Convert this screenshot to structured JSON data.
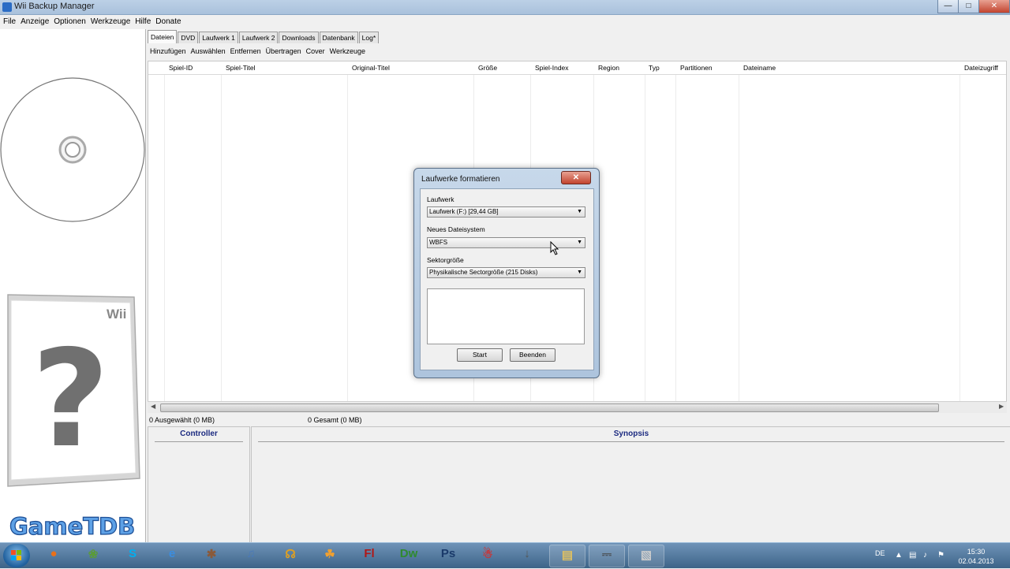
{
  "window": {
    "title": "Wii Backup Manager",
    "controls": {
      "minimize": "—",
      "maximize": "□",
      "close": "✕"
    }
  },
  "menu": [
    "File",
    "Anzeige",
    "Optionen",
    "Werkzeuge",
    "Hilfe",
    "Donate"
  ],
  "tabs": [
    "Dateien",
    "DVD",
    "Laufwerk 1",
    "Laufwerk 2",
    "Downloads",
    "Datenbank",
    "Log*"
  ],
  "active_tab": "Dateien",
  "toolbar": [
    "Hinzufügen",
    "Auswählen",
    "Entfernen",
    "Übertragen",
    "Cover",
    "Werkzeuge"
  ],
  "columns": [
    "Spiel-ID",
    "Spiel-Titel",
    "Original-Titel",
    "Größe",
    "Spiel-Index",
    "Region",
    "Typ",
    "Partitionen",
    "Dateiname",
    "Dateizugriff"
  ],
  "left_panel": {
    "box_brand": "Wii",
    "box_symbol": "?",
    "logo": "GameTDB"
  },
  "status": {
    "selected": "0 Ausgewählt (0 MB)",
    "total": "0 Gesamt (0 MB)"
  },
  "bottom": {
    "controller_title": "Controller",
    "synopsis_title": "Synopsis"
  },
  "dialog": {
    "title": "Laufwerke formatieren",
    "close": "✕",
    "drive_label": "Laufwerk",
    "drive_value": "Laufwerk (F:) [29,44 GB]",
    "fs_label": "Neues Dateisystem",
    "fs_value": "WBFS",
    "sector_label": "Sektorgröße",
    "sector_value": "Physikalische Sectorgröße (215 Disks)",
    "log_text": "",
    "start_button": "Start",
    "close_button": "Beenden"
  },
  "taskbar": {
    "apps": [
      {
        "name": "firefox-icon",
        "glyph": "●",
        "color": "#e8701a"
      },
      {
        "name": "game-icon",
        "glyph": "❀",
        "color": "#5a9a3a"
      },
      {
        "name": "skype-icon",
        "glyph": "S",
        "color": "#00aff0"
      },
      {
        "name": "ie-icon",
        "glyph": "e",
        "color": "#3a8de0"
      },
      {
        "name": "spider-icon",
        "glyph": "✱",
        "color": "#8a5a3a"
      },
      {
        "name": "itunes-icon",
        "glyph": "♫",
        "color": "#4a7ab8"
      },
      {
        "name": "headset-icon",
        "glyph": "☊",
        "color": "#e0a020"
      },
      {
        "name": "fruity-icon",
        "glyph": "☘",
        "color": "#f0a030"
      },
      {
        "name": "flash-icon",
        "glyph": "Fl",
        "color": "#b01818"
      },
      {
        "name": "dreamweaver-icon",
        "glyph": "Dw",
        "color": "#2f8a2f"
      },
      {
        "name": "photoshop-icon",
        "glyph": "Ps",
        "color": "#1a3a6a"
      },
      {
        "name": "santa-icon",
        "glyph": "☃",
        "color": "#d03030"
      },
      {
        "name": "microphone-icon",
        "glyph": "↓",
        "color": "#555555"
      },
      {
        "name": "folder-icon",
        "glyph": "▤",
        "color": "#e0c060"
      },
      {
        "name": "usb-icon",
        "glyph": "⎓",
        "color": "#444444"
      },
      {
        "name": "wii-backup-icon",
        "glyph": "▧",
        "color": "#cccccc"
      }
    ],
    "tray": {
      "language": "DE",
      "time": "15:30",
      "date": "02.04.2013"
    }
  }
}
